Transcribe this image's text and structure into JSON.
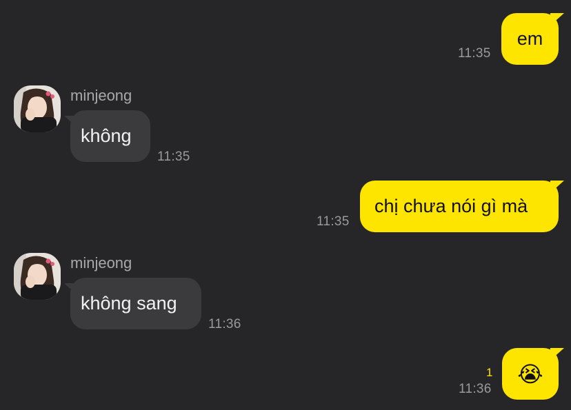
{
  "messages": [
    {
      "direction": "outgoing",
      "text": "em",
      "time": "11:35"
    },
    {
      "direction": "incoming",
      "sender": "minjeong",
      "text": "không",
      "time": "11:35"
    },
    {
      "direction": "outgoing",
      "text": "chị chưa nói gì mà",
      "time": "11:35"
    },
    {
      "direction": "incoming",
      "sender": "minjeong",
      "text": "không sang",
      "time": "11:36"
    },
    {
      "direction": "outgoing",
      "text": "😭",
      "time": "11:36",
      "unread_count": "1"
    }
  ],
  "colors": {
    "background": "#262628",
    "outgoing_bubble": "#fee500",
    "incoming_bubble": "#3b3b3e",
    "timestamp": "#9a9a9c",
    "unread_badge": "#fee500"
  },
  "icons": {
    "sender_avatar": "profile-photo-avatar",
    "emoji": "loudly-crying-face"
  }
}
